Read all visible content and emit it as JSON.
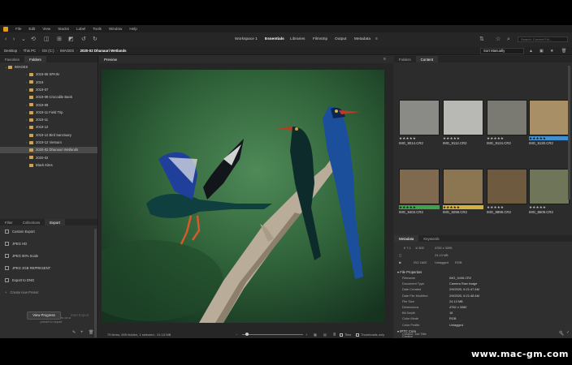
{
  "menu": [
    "File",
    "Edit",
    "View",
    "Stacks",
    "Label",
    "Tools",
    "Window",
    "Help"
  ],
  "workspaces": [
    "Workspace 1",
    "Essentials",
    "Libraries",
    "Filmstrip",
    "Output",
    "Metadata"
  ],
  "search_placeholder": "Search: Current Fol...",
  "breadcrumb": [
    "Desktop",
    "This PC",
    "OS (C:)",
    "IMAGES",
    "2020-02 Dhanauri Wetlands"
  ],
  "sort": "Sort Manually",
  "left_tabs": [
    "Favorites",
    "Folders"
  ],
  "folders": [
    {
      "label": "IMAGES",
      "arrow": "⌄",
      "indent": 0
    },
    {
      "label": "2019-06 SPAIN",
      "arrow": "›",
      "indent": 1
    },
    {
      "label": "2019",
      "arrow": "›",
      "indent": 1
    },
    {
      "label": "2019-07",
      "arrow": "›",
      "indent": 1
    },
    {
      "label": "2019-08 Crocodile Bank",
      "arrow": "",
      "indent": 1
    },
    {
      "label": "2019-08",
      "arrow": "›",
      "indent": 1
    },
    {
      "label": "2019-11 Field Trip",
      "arrow": "›",
      "indent": 1
    },
    {
      "label": "2019-11",
      "arrow": "›",
      "indent": 1
    },
    {
      "label": "2019-12",
      "arrow": "›",
      "indent": 1
    },
    {
      "label": "2019-12 Bird Sanctuary",
      "arrow": "",
      "indent": 1
    },
    {
      "label": "2019-12 Vietnam",
      "arrow": "›",
      "indent": 1
    },
    {
      "label": "2020-02 Dhanauri Wetlands",
      "arrow": "",
      "indent": 1
    },
    {
      "label": "2020-02",
      "arrow": "›",
      "indent": 1
    },
    {
      "label": "Black Kites",
      "arrow": "",
      "indent": 1
    }
  ],
  "bottom_tabs": [
    "Filter",
    "Collections",
    "Export"
  ],
  "export_items": [
    "Custom Export",
    "JPEG HD",
    "JPEG 80% Scale",
    "JPEG 2GB REPRESENT",
    "Export to DNG",
    "Create new Preset"
  ],
  "drop_hint": [
    "Drag and Drop images on a",
    "preset to export"
  ],
  "view_progress": "View Progress",
  "start_export": "Start Export",
  "preview_title": "Preview",
  "status_text": "75 items, 609 hidden, 1 selected - 24.13 MB",
  "thumbs_toggle": "Thumbnails only",
  "tiles_label": "Tiles",
  "right_tabs": [
    "Folders",
    "Content"
  ],
  "thumbnails": [
    {
      "name": "IMG_9014.CR2",
      "rating": "★★★★★",
      "label": "",
      "tone": "#8a8a86"
    },
    {
      "name": "IMG_9112.CR2",
      "rating": "★★★★★",
      "label": "",
      "tone": "#b8b8b5"
    },
    {
      "name": "IMG_9124.CR2",
      "rating": "★★★★★",
      "label": "",
      "tone": "#7b7a72"
    },
    {
      "name": "IMG_9130.CR2",
      "rating": "★★★★★",
      "label": "blue",
      "tone": "#a88f66"
    },
    {
      "name": "IMG_9403.CR2",
      "rating": "★★★★★",
      "label": "green",
      "tone": "#7f6a4f"
    },
    {
      "name": "IMG_9298.CR2",
      "rating": "★★★★★",
      "label": "yellow",
      "tone": "#8c7651"
    },
    {
      "name": "IMG_8899.CR2",
      "rating": "★★★★★",
      "label": "",
      "tone": "#6e5a3e"
    },
    {
      "name": "IMG_8609.CR2",
      "rating": "★★★★★",
      "label": "",
      "tone": "#6f7558"
    }
  ],
  "meta_tabs": [
    "Metadata",
    "Keywords"
  ],
  "meta_summary": [
    {
      "k": "f/ 7.1",
      "v": "4782 x 3395"
    },
    {
      "k": "1/ 800",
      "v": "24.13 MB"
    },
    {
      "k": "ISO 1600",
      "v": "Untagged"
    },
    {
      "k": "",
      "v": "RGB"
    }
  ],
  "file_properties_title": "File Properties",
  "file_properties": [
    {
      "k": "Filename",
      "v": "IMG_9406.CR2"
    },
    {
      "k": "Document Type",
      "v": "Camera Raw image"
    },
    {
      "k": "Date Created",
      "v": "2/9/2020, 6:21:47 AM"
    },
    {
      "k": "Date File Modified",
      "v": "2/9/2020, 6:21:48 AM"
    },
    {
      "k": "File Size",
      "v": "24.13 MB"
    },
    {
      "k": "Dimensions",
      "v": "4782 x 3380"
    },
    {
      "k": "Bit Depth",
      "v": "16"
    },
    {
      "k": "Color Mode",
      "v": "RGB"
    },
    {
      "k": "Color Profile",
      "v": "Untagged"
    }
  ],
  "iptc_title": "IPTC Core",
  "iptc": [
    {
      "k": "Creator",
      "v": ""
    },
    {
      "k": "Creator: Job Title",
      "v": ""
    }
  ],
  "watermark": "www.mac-gm.com"
}
